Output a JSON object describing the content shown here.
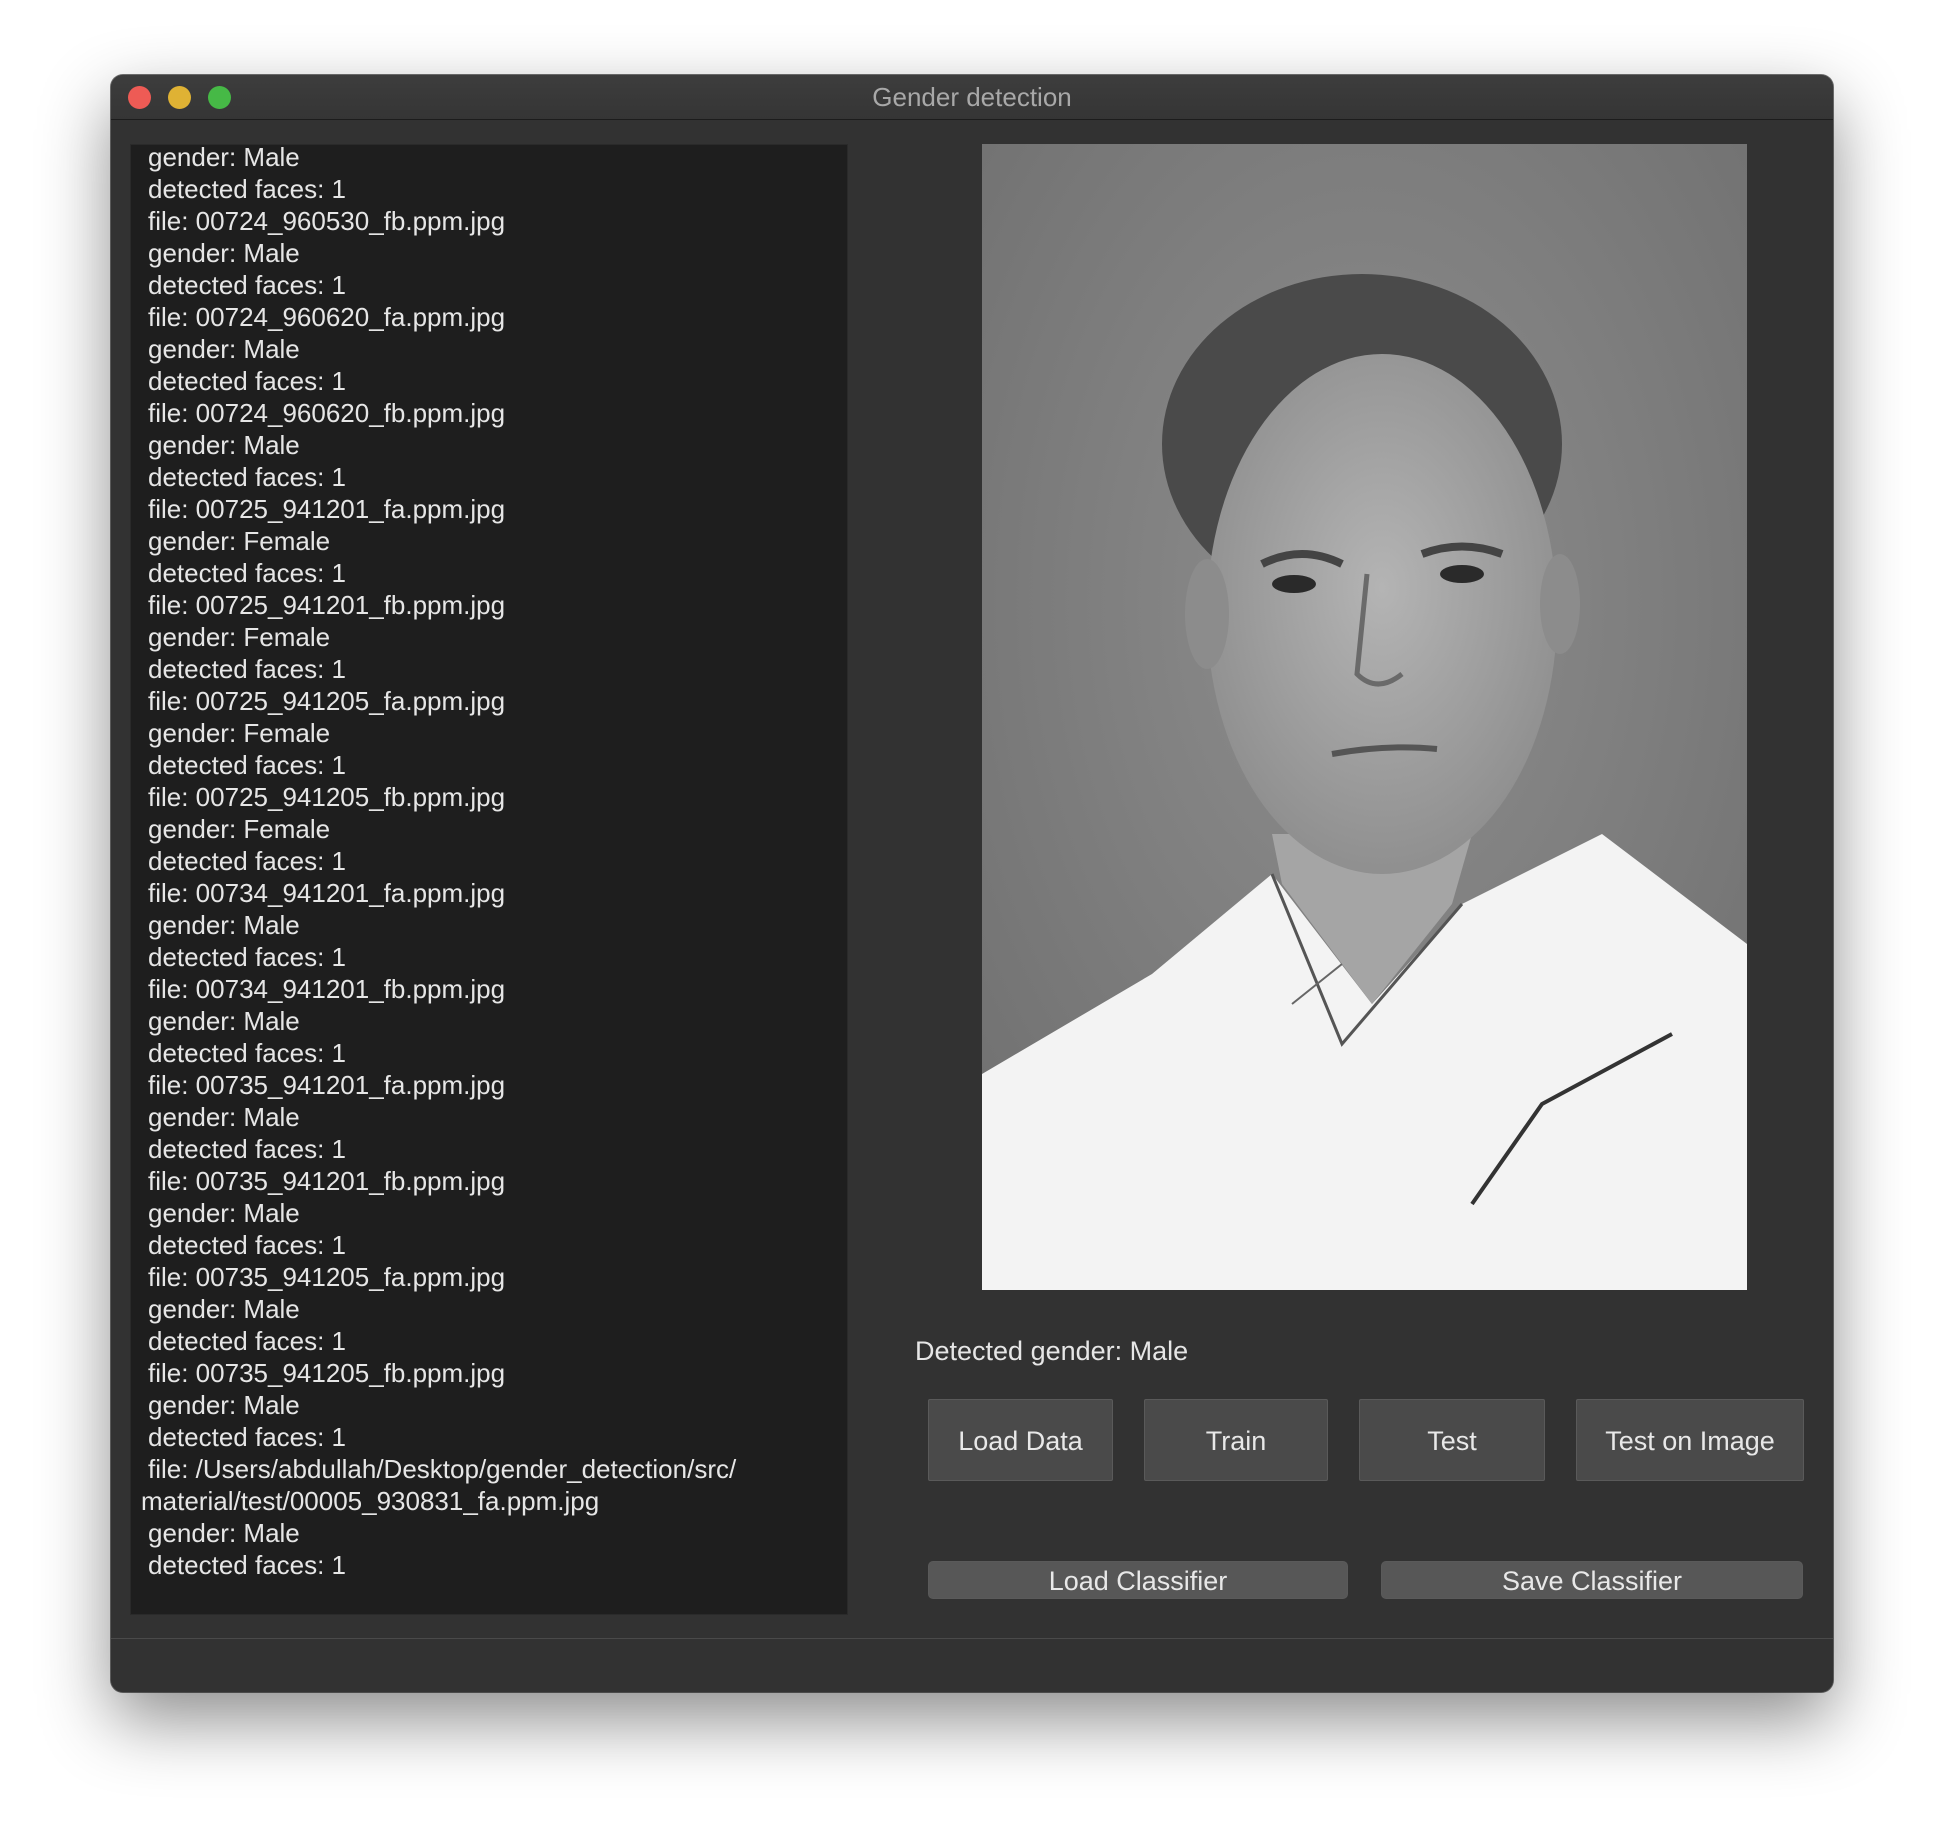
{
  "window": {
    "title": "Gender detection"
  },
  "log": {
    "lines": [
      "gender: Male",
      "detected faces: 1",
      "file: 00724_960530_fb.ppm.jpg",
      "gender: Male",
      "detected faces: 1",
      "file: 00724_960620_fa.ppm.jpg",
      "gender: Male",
      "detected faces: 1",
      "file: 00724_960620_fb.ppm.jpg",
      "gender: Male",
      "detected faces: 1",
      "file: 00725_941201_fa.ppm.jpg",
      "gender: Female",
      "detected faces: 1",
      "file: 00725_941201_fb.ppm.jpg",
      "gender: Female",
      "detected faces: 1",
      "file: 00725_941205_fa.ppm.jpg",
      "gender: Female",
      "detected faces: 1",
      "file: 00725_941205_fb.ppm.jpg",
      "gender: Female",
      "detected faces: 1",
      "file: 00734_941201_fa.ppm.jpg",
      "gender: Male",
      "detected faces: 1",
      "file: 00734_941201_fb.ppm.jpg",
      "gender: Male",
      "detected faces: 1",
      "file: 00735_941201_fa.ppm.jpg",
      "gender: Male",
      "detected faces: 1",
      "file: 00735_941201_fb.ppm.jpg",
      "gender: Male",
      "detected faces: 1",
      "file: 00735_941205_fa.ppm.jpg",
      "gender: Male",
      "detected faces: 1",
      "file: 00735_941205_fb.ppm.jpg",
      "gender: Male",
      "detected faces: 1",
      "file: /Users/abdullah/Desktop/gender_detection/src/",
      "material/test/00005_930831_fa.ppm.jpg",
      "gender: Male",
      "detected faces: 1"
    ]
  },
  "result": {
    "label": "Detected gender: Male"
  },
  "buttons": {
    "load_data": "Load Data",
    "train": "Train",
    "test": "Test",
    "test_on_image": "Test on Image",
    "load_classifier": "Load Classifier",
    "save_classifier": "Save Classifier"
  },
  "colors": {
    "window_bg": "#323232",
    "log_bg": "#1e1e1e",
    "button_bg": "#4a4a4a",
    "close": "#ee5b55",
    "minimize": "#dfb234",
    "zoom": "#46b946"
  }
}
